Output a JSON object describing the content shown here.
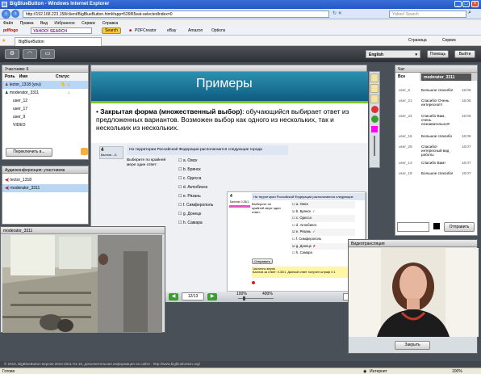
{
  "window": {
    "title": "BigBlueButton - Windows Internet Explorer"
  },
  "browser": {
    "url": "http://192.168.223.158/client/BigBlueButton.html#app=526f65eat-selectedIndex=0",
    "search_placeholder": "Yahoo! Search",
    "menu": [
      "Файл",
      "Правка",
      "Вид",
      "Избранное",
      "Сервис",
      "Справка"
    ],
    "links": [
      "pdflogo",
      "YAHOO! SEARCH",
      "Search",
      "PDFCreator",
      "eBay",
      "Amazon",
      "Options"
    ],
    "tab_title": "BigBlueButton",
    "right_tools": [
      "Страница",
      "Сервис"
    ]
  },
  "app": {
    "language": "English",
    "help_label": "Помощь",
    "exit_label": "Выйти"
  },
  "participants": {
    "title": "Участники: 6",
    "col_role": "Роль",
    "col_name": "Имя",
    "col_status": "Статус",
    "rows": [
      {
        "name": "lector_1318 (you)",
        "role": "presenter"
      },
      {
        "name": "moderator_3311",
        "role": "moderator"
      },
      {
        "name": "user_12",
        "role": ""
      },
      {
        "name": "user_17",
        "role": ""
      },
      {
        "name": "user_9",
        "role": ""
      },
      {
        "name": "VIDEO",
        "role": ""
      }
    ],
    "switch_label": "Переключить в..."
  },
  "audio": {
    "title": "Аудиоконференция: участников",
    "rows": [
      "lector_1318",
      "moderator_3311"
    ]
  },
  "presentation": {
    "slide_title": "Примеры",
    "bullet_bold": "Закрытая форма (множественный выбор)",
    "bullet_text": ": обучающийся выбирает ответ из предложенных вариантов. Возможен выбор как одного из нескольких, так и нескольких из нескольких.",
    "quiz1": {
      "number": "4",
      "points": "Баллов: --/1",
      "question": "На территории Российской Федерации располагаются следующие города",
      "prompt": "Выберите по крайней мере один ответ:",
      "options": [
        "a. Омск",
        "b. Брянск",
        "c. Одесса",
        "d. Актюбинск",
        "e. Рязань",
        "f. Симферополь",
        "g. Донецк",
        "h. Самара"
      ]
    },
    "quiz2": {
      "number": "4",
      "points": "Баллов: 0.33/1",
      "question": "На территории Российской Федерации располагаются следующие",
      "prompt": "Выберите по крайней мере один ответ:",
      "options": [
        "a. Омск",
        "b. Брянск",
        "c. Одесса",
        "d. Актюбинск",
        "e. Рязань",
        "f. Симферополь",
        "g. Донецк",
        "h. Самара"
      ],
      "checked": [
        false,
        true,
        false,
        false,
        true,
        false,
        true,
        false
      ],
      "marks": [
        "",
        "✓",
        "",
        "",
        "✓",
        "",
        "✗",
        ""
      ],
      "submit_label": "Отправить",
      "feedback": "Частично верно",
      "feedback_detail": "Баллов за ответ: 0.33/1. Данный ответ получен штраф 0.1"
    },
    "page": "12/13",
    "zoom_left": "100%",
    "zoom_right": "400%"
  },
  "chat": {
    "title": "Чат",
    "tab_all": "Все",
    "tab_user": "moderator_3311",
    "messages": [
      {
        "user": "user_6",
        "text": "Большое спасибо!",
        "time": "16:06"
      },
      {
        "user": "user_21",
        "text": "Спасибо! Очень интересно!!!",
        "time": "16:06"
      },
      {
        "user": "user_23",
        "text": "Спасибо Вам, очень познавательно!!!",
        "time": "16:06"
      },
      {
        "user": "user_16",
        "text": "Большое спасибо",
        "time": "16:06"
      },
      {
        "user": "user_29",
        "text": "Спасибо! интересный вид работы",
        "time": "16:07"
      },
      {
        "user": "user_13",
        "text": "Спасибо Вам!",
        "time": "16:07"
      },
      {
        "user": "user_19",
        "text": "Большое спасибо!",
        "time": "16:07"
      }
    ],
    "send_label": "Отправить"
  },
  "video_left": {
    "title": "moderator_3311"
  },
  "video_right": {
    "title": "Видеотрансляция",
    "close_label": "Закрыть"
  },
  "footer_text": "© 2010, BigBlueButton версия 2010-2011-01-15, дополнительная информация на сайте : http://www.bigbluebutton.org/",
  "status": {
    "left": "Готово",
    "zone": "Интернет",
    "zoom": "100%"
  }
}
